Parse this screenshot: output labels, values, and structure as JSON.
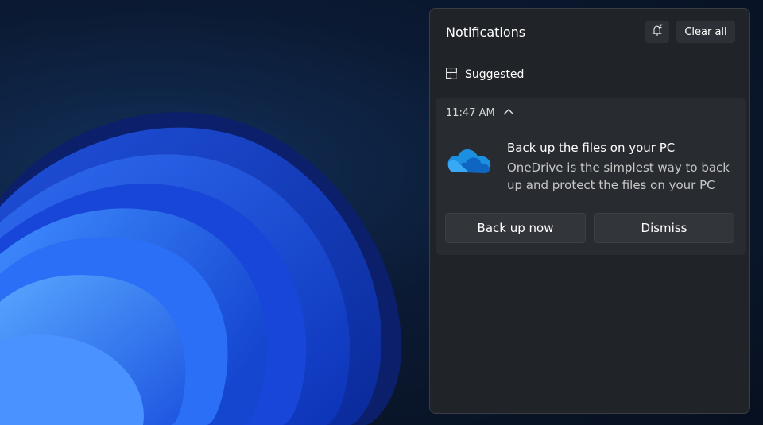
{
  "panel": {
    "title": "Notifications",
    "clear_all_label": "Clear all",
    "dnd_icon": "bell-snooze-icon"
  },
  "group": {
    "label": "Suggested",
    "icon": "suggested-grid-icon"
  },
  "notification": {
    "time": "11:47 AM",
    "expand_icon": "chevron-up-icon",
    "app_icon": "onedrive-cloud-icon",
    "title": "Back up the files on your PC",
    "body": "OneDrive is the simplest way to back up and protect the files on your PC",
    "actions": [
      {
        "label": "Back up now"
      },
      {
        "label": "Dismiss"
      }
    ]
  },
  "colors": {
    "panel_bg": "#202328",
    "card_bg": "#282b30",
    "button_bg": "#32353a",
    "onedrive_blue": "#1b8fe0"
  }
}
